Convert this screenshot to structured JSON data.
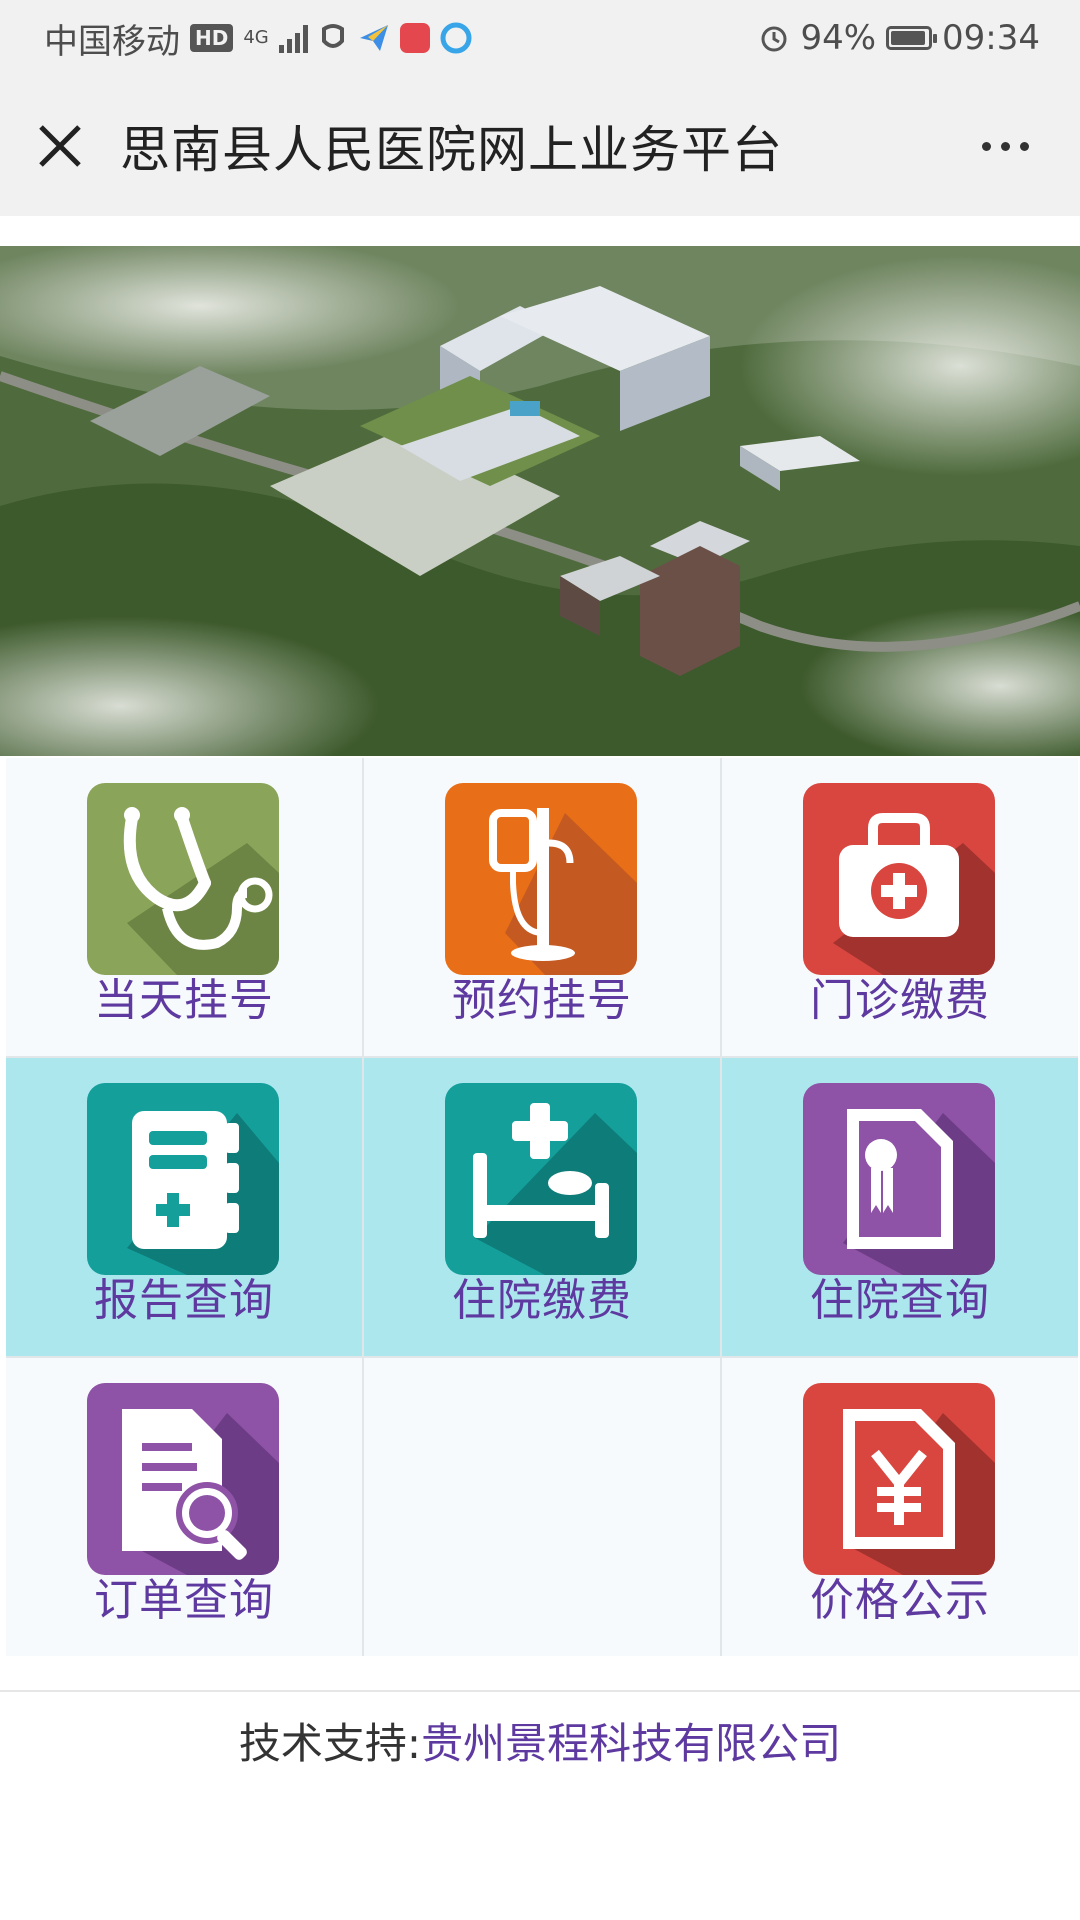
{
  "status_bar": {
    "carrier": "中国移动",
    "hd": "HD",
    "network": "4G",
    "battery": "94%",
    "time": "09:34",
    "battery_level": 0.94
  },
  "nav": {
    "title": "思南县人民医院网上业务平台"
  },
  "tiles": [
    {
      "label": "当天挂号",
      "icon": "stethoscope-icon",
      "color": "#8aa45a"
    },
    {
      "label": "预约挂号",
      "icon": "iv-drip-icon",
      "color": "#e86f17"
    },
    {
      "label": "门诊缴费",
      "icon": "medical-kit-icon",
      "color": "#d8463f"
    },
    {
      "label": "报告查询",
      "icon": "medical-report-icon",
      "color": "#159f9b"
    },
    {
      "label": "住院缴费",
      "icon": "hospital-bed-icon",
      "color": "#159f9b"
    },
    {
      "label": "住院查询",
      "icon": "certificate-icon",
      "color": "#8e52a6"
    },
    {
      "label": "订单查询",
      "icon": "document-search-icon",
      "color": "#8e52a6"
    },
    {
      "label": "",
      "icon": "",
      "color": ""
    },
    {
      "label": "价格公示",
      "icon": "price-document-icon",
      "color": "#d8463f"
    }
  ],
  "footer": {
    "prefix": "技术支持:",
    "company": "贵州景程科技有限公司"
  },
  "colors": {
    "label": "#5e3aa0",
    "teal_row": "#ade7ee"
  }
}
